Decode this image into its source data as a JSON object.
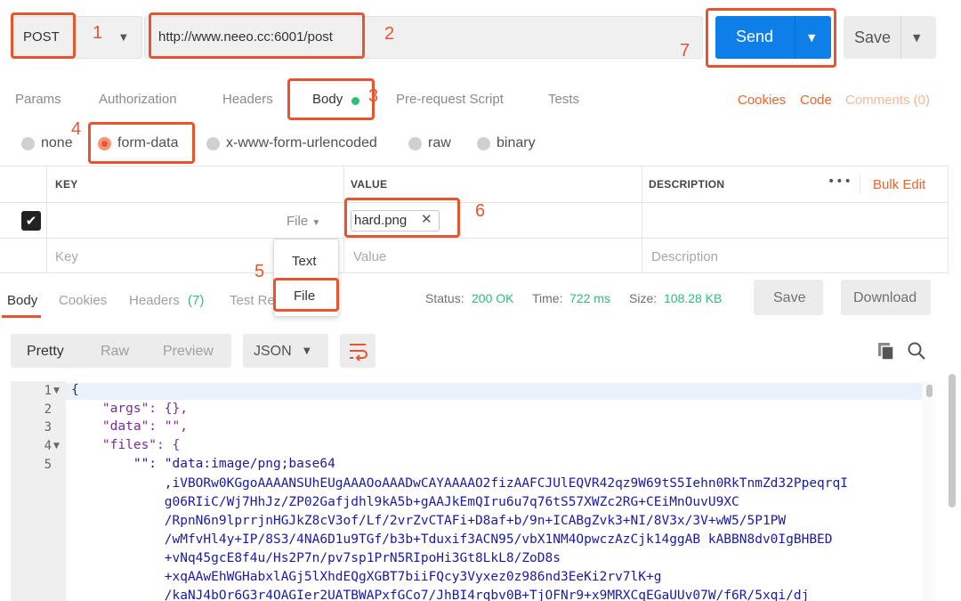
{
  "request": {
    "method": "POST",
    "url": "http://www.neeo.cc:6001/post",
    "send_label": "Send",
    "save_label": "Save"
  },
  "request_tabs": [
    "Params",
    "Authorization",
    "Headers",
    "Body",
    "Pre-request Script",
    "Tests"
  ],
  "right_links": {
    "cookies": "Cookies",
    "code": "Code",
    "comments": "Comments (0)"
  },
  "body_types": [
    "none",
    "form-data",
    "x-www-form-urlencoded",
    "raw",
    "binary"
  ],
  "table": {
    "headers": {
      "key": "KEY",
      "value": "VALUE",
      "description": "DESCRIPTION"
    },
    "bulk_edit": "Bulk Edit",
    "more": "•••",
    "row1": {
      "type": "File",
      "file_name": "hard.png"
    },
    "placeholders": {
      "key": "Key",
      "value": "Value",
      "description": "Description"
    }
  },
  "type_dropdown": [
    "Text",
    "File"
  ],
  "response": {
    "tabs": {
      "body": "Body",
      "cookies": "Cookies",
      "headers": "Headers",
      "headers_count": "(7)",
      "tests": "Test Re"
    },
    "status_label": "Status:",
    "status_value": "200 OK",
    "time_label": "Time:",
    "time_value": "722 ms",
    "size_label": "Size:",
    "size_value": "108.28 KB",
    "save_label": "Save",
    "download_label": "Download",
    "view_tabs": [
      "Pretty",
      "Raw",
      "Preview"
    ],
    "format": "JSON"
  },
  "code": {
    "line_numbers": [
      "1",
      "2",
      "3",
      "4",
      "5"
    ],
    "lines": [
      "{",
      "    \"args\": {},",
      "    \"data\": \"\",",
      "    \"files\": {",
      "        \"\": \"data:image/png;base64",
      "            ,iVBORw0KGgoAAAANSUhEUgAAAOoAAADwCAYAAAAO2fizAAFCJUlEQVR42qz9W69tS5Iehn0RkTnmZd32PpeqrqI",
      "            g06RIiC/Wj7HhJz/ZP02Gafjdhl9kA5b+gAAJkEmQIru6u7q76tS57XWZc2RG+CEiMnOuvU9XC",
      "            /RpnN6n9lprrjnHGJkZ8cV3of/Lf/2vrZvCTAFi+D8af+b/9n+ICABgZvk3+NI/8V3x/3V+wW5/5P1PW",
      "            /wMfvHl4y+IP/8S3/4NA6D1u9TGf/b3b+Tduxif3ACN95/vbX1NM4OpwczAzCjk14ggAB kABBN8dv0IgBHBED",
      "            +vNq45gcE8f4u/Hs2P7n/pv7sp1PrN5RIpoHi3Gt8LkL8/ZoD8s",
      "            +xqAAwEhWGHabxlAGj5lXhdEQgXGBT7biiFQcy3Vyxez0z986nd3EeKi2rv7lK+g",
      "            /kaNJ4bOr6G3r4OAGIer2UATBWAPxfGCo7/JhBI4rqbv0B+TjOFNr9+x9MRXCqEGaUUv07W/f6R/5xqi/dj"
    ]
  },
  "annotations": [
    "1",
    "2",
    "3",
    "4",
    "5",
    "6",
    "7"
  ],
  "colors": {
    "accent": "#e8542e",
    "primary": "#0e7fe8",
    "success": "#2dbe7a"
  }
}
